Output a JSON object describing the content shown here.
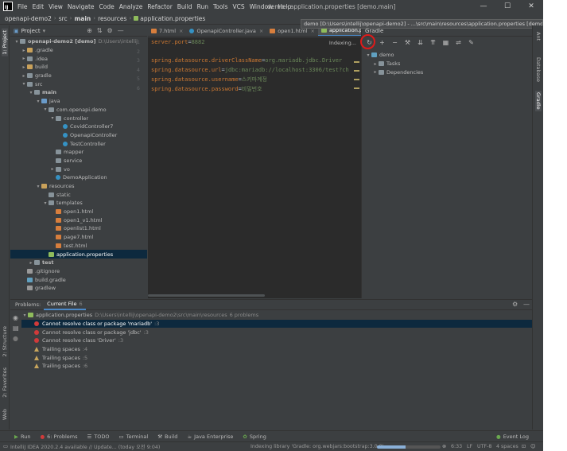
{
  "app": {
    "logo": "IJ",
    "menu": [
      "File",
      "Edit",
      "View",
      "Navigate",
      "Code",
      "Analyze",
      "Refactor",
      "Build",
      "Run",
      "Tools",
      "VCS",
      "Window",
      "Help"
    ],
    "window_title": "demo - application.properties [demo.main]"
  },
  "breadcrumb": [
    "openapi-demo2",
    "src",
    "main",
    "resources",
    "application.properties"
  ],
  "project_panel": {
    "title": "Project",
    "tree": [
      {
        "label": "openapi-demo2 [demo]",
        "hint": "D:\\Users\\intellij",
        "depth": 0,
        "toggle": "▾",
        "icon": "folder",
        "bold": true
      },
      {
        "label": ".gradle",
        "depth": 1,
        "toggle": "▸",
        "icon": "folder-orange"
      },
      {
        "label": ".idea",
        "depth": 1,
        "toggle": "▸",
        "icon": "folder"
      },
      {
        "label": "build",
        "depth": 1,
        "toggle": "▸",
        "icon": "folder-orange"
      },
      {
        "label": "gradle",
        "depth": 1,
        "toggle": "▸",
        "icon": "folder"
      },
      {
        "label": "src",
        "depth": 1,
        "toggle": "▾",
        "icon": "folder"
      },
      {
        "label": "main",
        "depth": 2,
        "toggle": "▾",
        "icon": "folder",
        "bold": true
      },
      {
        "label": "java",
        "depth": 3,
        "toggle": "▾",
        "icon": "folder-blue"
      },
      {
        "label": "com.openapi.demo",
        "depth": 4,
        "toggle": "▾",
        "icon": "folder"
      },
      {
        "label": "controller",
        "depth": 5,
        "toggle": "▾",
        "icon": "folder"
      },
      {
        "label": "CovidController7",
        "depth": 6,
        "toggle": "",
        "icon": "class"
      },
      {
        "label": "OpenapiController",
        "depth": 6,
        "toggle": "",
        "icon": "class"
      },
      {
        "label": "TestController",
        "depth": 6,
        "toggle": "",
        "icon": "class"
      },
      {
        "label": "mapper",
        "depth": 5,
        "toggle": "",
        "icon": "folder"
      },
      {
        "label": "service",
        "depth": 5,
        "toggle": "",
        "icon": "folder"
      },
      {
        "label": "vo",
        "depth": 5,
        "toggle": "▸",
        "icon": "folder"
      },
      {
        "label": "DemoApplication",
        "depth": 5,
        "toggle": "",
        "icon": "class"
      },
      {
        "label": "resources",
        "depth": 3,
        "toggle": "▾",
        "icon": "folder-orange"
      },
      {
        "label": "static",
        "depth": 4,
        "toggle": "",
        "icon": "folder"
      },
      {
        "label": "templates",
        "depth": 4,
        "toggle": "▾",
        "icon": "folder"
      },
      {
        "label": "open1.html",
        "depth": 5,
        "toggle": "",
        "icon": "html"
      },
      {
        "label": "open1_v1.html",
        "depth": 5,
        "toggle": "",
        "icon": "html"
      },
      {
        "label": "openlist1.html",
        "depth": 5,
        "toggle": "",
        "icon": "html"
      },
      {
        "label": "page7.html",
        "depth": 5,
        "toggle": "",
        "icon": "html"
      },
      {
        "label": "test.html",
        "depth": 5,
        "toggle": "",
        "icon": "html"
      },
      {
        "label": "application.properties",
        "depth": 4,
        "toggle": "",
        "icon": "props",
        "selected": true
      },
      {
        "label": "test",
        "depth": 2,
        "toggle": "▸",
        "icon": "folder",
        "bold": true
      },
      {
        "label": ".gitignore",
        "depth": 1,
        "toggle": "",
        "icon": "git"
      },
      {
        "label": "build.gradle",
        "depth": 1,
        "toggle": "",
        "icon": "gradle"
      },
      {
        "label": "gradlew",
        "depth": 1,
        "toggle": "",
        "icon": "git"
      }
    ]
  },
  "editor": {
    "tabs": [
      {
        "label": "7.html",
        "icon": "html",
        "active": false
      },
      {
        "label": "OpenapiController.java",
        "icon": "class",
        "active": false
      },
      {
        "label": "open1.html",
        "icon": "html",
        "active": false
      },
      {
        "label": "application.properties",
        "icon": "props",
        "active": true
      }
    ],
    "indexing": "Indexing...",
    "lines": [
      {
        "no": "1",
        "key": "server.port",
        "value": "8882"
      },
      {
        "no": "2",
        "key": "",
        "value": ""
      },
      {
        "no": "3",
        "key": "spring.datasource.driverClassName",
        "value": "org.mariadb.jdbc.Driver"
      },
      {
        "no": "4",
        "key": "spring.datasource.url",
        "value": "jdbc:mariadb://localhost:3306/test?ch"
      },
      {
        "no": "5",
        "key": "spring.datasource.username",
        "value": "스키마계정"
      },
      {
        "no": "6",
        "key": "spring.datasource.password",
        "value": "비밀번호"
      }
    ]
  },
  "gradle_panel": {
    "tooltip": "demo [D:\\Users\\intellij\\openapi-demo2] - ...\\src\\main\\resources\\application.properties [demo.main]",
    "title": "Gradle",
    "tree": [
      {
        "label": "demo",
        "toggle": "▾",
        "depth": 0
      },
      {
        "label": "Tasks",
        "toggle": "▸",
        "depth": 1
      },
      {
        "label": "Dependencies",
        "toggle": "▸",
        "depth": 1
      }
    ]
  },
  "right_stripe": [
    "Ant",
    "Database",
    "Gradle"
  ],
  "left_stripe": [
    "1: Project",
    "2: Structure",
    "2: Favorites",
    "Web"
  ],
  "problems": {
    "tabs": [
      {
        "label": "Problems:",
        "count": "",
        "active": false
      },
      {
        "label": "Current File",
        "count": "6",
        "active": true
      }
    ],
    "file_row": {
      "label": "application.properties",
      "path": "D:\\Users\\intellij\\openapi-demo2\\src\\main\\resources",
      "summary": "6 problems"
    },
    "items": [
      {
        "type": "error",
        "text": "Cannot resolve class or package 'mariadb'",
        "line": ":3",
        "selected": true
      },
      {
        "type": "error",
        "text": "Cannot resolve class or package 'jdbc'",
        "line": ":3",
        "selected": false
      },
      {
        "type": "error",
        "text": "Cannot resolve class 'Driver'",
        "line": ":3",
        "selected": false
      },
      {
        "type": "warning",
        "text": "Trailing spaces",
        "line": ":4",
        "selected": false
      },
      {
        "type": "warning",
        "text": "Trailing spaces",
        "line": ":5",
        "selected": false
      },
      {
        "type": "warning",
        "text": "Trailing spaces",
        "line": ":6",
        "selected": false
      }
    ]
  },
  "bottom_tabs": [
    {
      "label": "Run",
      "icon": "▶"
    },
    {
      "label": "6: Problems",
      "icon": "●"
    },
    {
      "label": "TODO",
      "icon": "☰"
    },
    {
      "label": "Terminal",
      "icon": "▭"
    },
    {
      "label": "Build",
      "icon": "⚒"
    },
    {
      "label": "Java Enterprise",
      "icon": "☕"
    },
    {
      "label": "Spring",
      "icon": "✿"
    }
  ],
  "event_log": "Event Log",
  "status": {
    "message": "IntelliJ IDEA 2020.2.4 available // Update... (today 오전 9:04)",
    "indexing": "Indexing library 'Gradle: org.webjars:bootstrap:3.0.0'",
    "progress": 0.45,
    "position": "6:33",
    "line_sep": "LF",
    "encoding": "UTF-8",
    "indent": "4 spaces"
  },
  "colors": {
    "accent": "#4a88c7",
    "highlight_circle": "#e01a1a",
    "error": "#d03a3a",
    "warning": "#c7a55c"
  }
}
